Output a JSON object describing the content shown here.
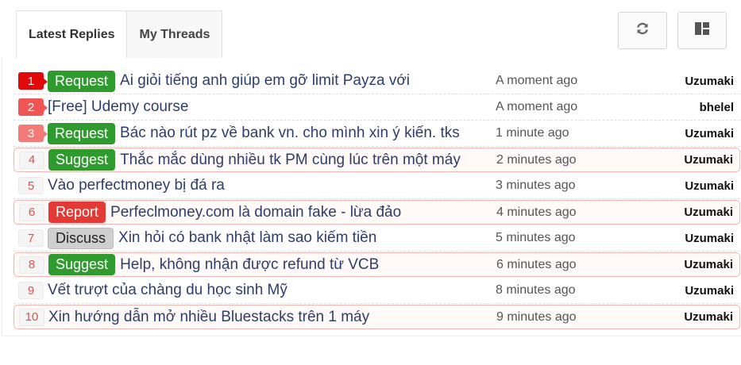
{
  "tabs": [
    {
      "label": "Latest Replies"
    },
    {
      "label": "My Threads"
    }
  ],
  "colors": {
    "request": "#2f9b2f",
    "suggest": "#2f9b2f",
    "report": "#e53935",
    "discuss": "#cfcfcf"
  },
  "toolbar": {
    "refresh_icon": "refresh-icon",
    "layout_icon": "layout-icon"
  },
  "threads": [
    {
      "rank": "1",
      "tag": "Request",
      "tag_type": "request",
      "title": "Ai giỏi tiếng anh giúp em gỡ limit Payza với",
      "time": "A moment ago",
      "user": "Uzumaki",
      "highlight": false
    },
    {
      "rank": "2",
      "tag": "",
      "tag_type": "",
      "title": "[Free] Udemy course",
      "time": "A moment ago",
      "user": "bhelel",
      "highlight": false
    },
    {
      "rank": "3",
      "tag": "Request",
      "tag_type": "request",
      "title": "Bác nào rút pz về bank vn. cho mình xin ý kiến. tks",
      "time": "1 minute ago",
      "user": "Uzumaki",
      "highlight": false
    },
    {
      "rank": "4",
      "tag": "Suggest",
      "tag_type": "suggest",
      "title": "Thắc mắc dùng nhiều tk PM cùng lúc trên một máy",
      "time": "2 minutes ago",
      "user": "Uzumaki",
      "highlight": true
    },
    {
      "rank": "5",
      "tag": "",
      "tag_type": "",
      "title": "Vào perfectmoney bị đá ra",
      "time": "3 minutes ago",
      "user": "Uzumaki",
      "highlight": false
    },
    {
      "rank": "6",
      "tag": "Report",
      "tag_type": "report",
      "title": "Perfeclmoney.com là domain fake - lừa đảo",
      "time": "4 minutes ago",
      "user": "Uzumaki",
      "highlight": true
    },
    {
      "rank": "7",
      "tag": "Discuss",
      "tag_type": "discuss",
      "title": "Xin hỏi có bank nhật làm sao kiếm tiền",
      "time": "5 minutes ago",
      "user": "Uzumaki",
      "highlight": false
    },
    {
      "rank": "8",
      "tag": "Suggest",
      "tag_type": "suggest",
      "title": "Help, không nhận được refund từ VCB",
      "time": "6 minutes ago",
      "user": "Uzumaki",
      "highlight": true
    },
    {
      "rank": "9",
      "tag": "",
      "tag_type": "",
      "title": "Vết trượt của chàng du học sinh Mỹ",
      "time": "8 minutes ago",
      "user": "Uzumaki",
      "highlight": false
    },
    {
      "rank": "10",
      "tag": "",
      "tag_type": "",
      "title": "Xin hướng dẫn mở nhiều Bluestacks trên 1 máy",
      "time": "9 minutes ago",
      "user": "Uzumaki",
      "highlight": true
    }
  ]
}
